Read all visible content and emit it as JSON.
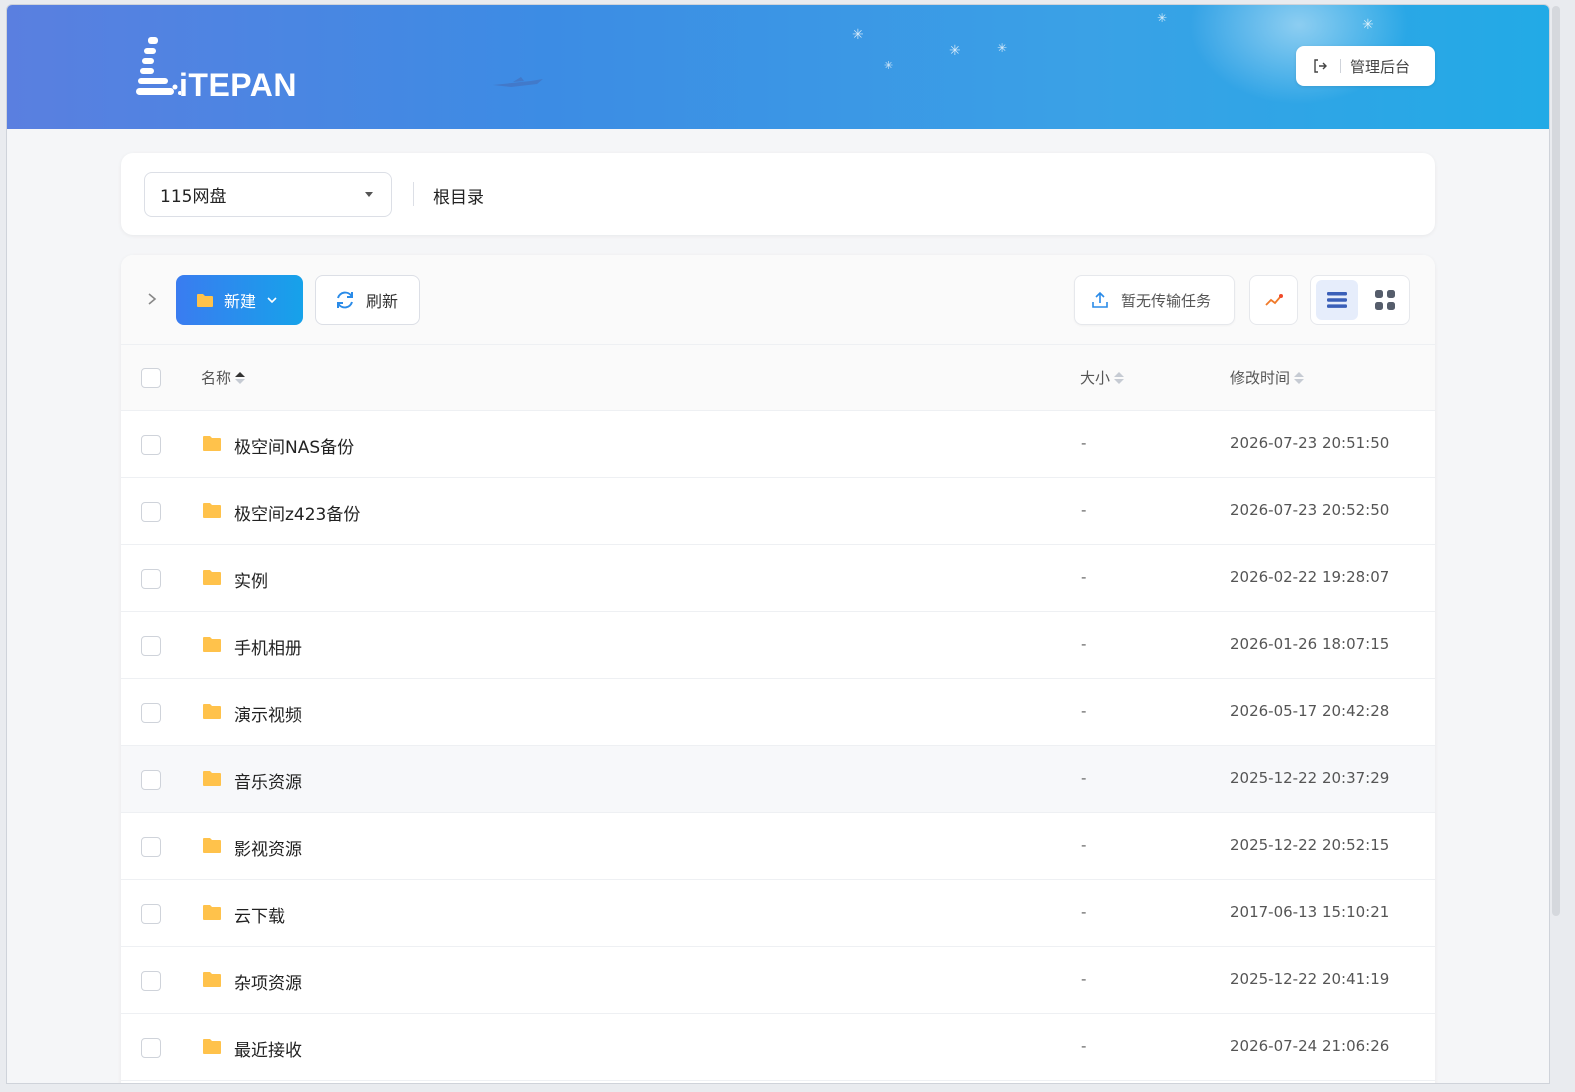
{
  "header": {
    "logo_text": "iTEPAN",
    "admin_label": "管理后台"
  },
  "path_bar": {
    "storage_selected": "115网盘",
    "breadcrumb_root": "根目录"
  },
  "toolbar": {
    "new_label": "新建",
    "refresh_label": "刷新",
    "transfer_label": "暂无传输任务"
  },
  "table": {
    "columns": {
      "name": "名称",
      "size": "大小",
      "modified": "修改时间"
    },
    "sort": {
      "column": "name",
      "direction": "asc"
    },
    "rows": [
      {
        "name": "极空间NAS备份",
        "size": "-",
        "modified": "2026-07-23 20:51:50"
      },
      {
        "name": "极空间z423备份",
        "size": "-",
        "modified": "2026-07-23 20:52:50"
      },
      {
        "name": "实例",
        "size": "-",
        "modified": "2026-02-22 19:28:07"
      },
      {
        "name": "手机相册",
        "size": "-",
        "modified": "2026-01-26 18:07:15"
      },
      {
        "name": "演示视频",
        "size": "-",
        "modified": "2026-05-17 20:42:28"
      },
      {
        "name": "音乐资源",
        "size": "-",
        "modified": "2025-12-22 20:37:29"
      },
      {
        "name": "影视资源",
        "size": "-",
        "modified": "2025-12-22 20:52:15"
      },
      {
        "name": "云下载",
        "size": "-",
        "modified": "2017-06-13 15:10:21"
      },
      {
        "name": "杂项资源",
        "size": "-",
        "modified": "2025-12-22 20:41:19"
      },
      {
        "name": "最近接收",
        "size": "-",
        "modified": "2026-07-24 21:06:26"
      }
    ]
  },
  "colors": {
    "primary": "#3a7cf0",
    "folder": "#ffc24b",
    "header_gradient": [
      "#5a7fe0",
      "#22aae6"
    ]
  },
  "icons": [
    "logo-icon",
    "logout-icon",
    "chevron-right-icon",
    "folder-icon",
    "chevron-down-icon",
    "refresh-icon",
    "upload-icon",
    "trend-chart-icon",
    "list-view-icon",
    "grid-view-icon",
    "sort-icon"
  ]
}
